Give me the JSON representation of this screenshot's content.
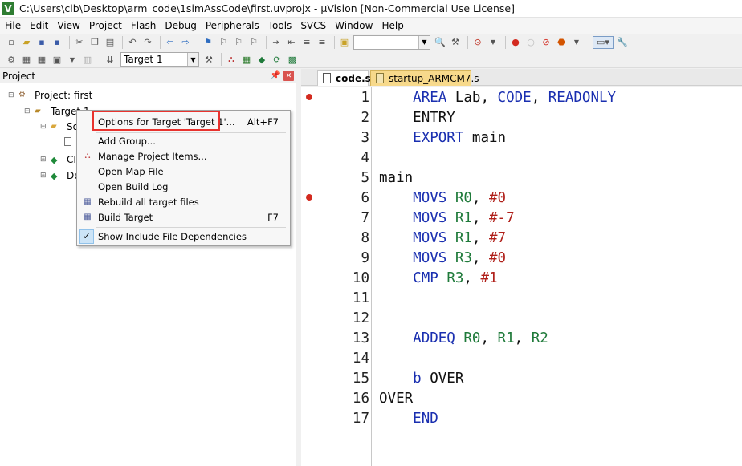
{
  "window": {
    "title": "C:\\Users\\clb\\Desktop\\arm_code\\1simAssCode\\first.uvprojx - µVision  [Non-Commercial Use License]",
    "app_icon_letter": "V"
  },
  "menubar": {
    "items": [
      "File",
      "Edit",
      "View",
      "Project",
      "Flash",
      "Debug",
      "Peripherals",
      "Tools",
      "SVCS",
      "Window",
      "Help"
    ]
  },
  "toolbar2": {
    "target_select": "Target 1"
  },
  "project_pane": {
    "header": "Project",
    "tree": {
      "project": "Project: first",
      "target": "Target 1",
      "group1_partial": "So",
      "group2_partial": "CI",
      "group3_partial": "De"
    }
  },
  "context_menu": {
    "items": [
      {
        "label": "Options for Target 'Target 1'...",
        "shortcut": "Alt+F7"
      },
      {
        "label": "Add Group...",
        "shortcut": ""
      },
      {
        "label": "Manage Project Items...",
        "shortcut": ""
      },
      {
        "label": "Open Map File",
        "shortcut": ""
      },
      {
        "label": "Open Build Log",
        "shortcut": ""
      },
      {
        "label": "Rebuild all target files",
        "shortcut": ""
      },
      {
        "label": "Build Target",
        "shortcut": "F7"
      },
      {
        "label": "Show Include File Dependencies",
        "shortcut": ""
      }
    ]
  },
  "editor": {
    "tabs": [
      {
        "label": "code.s",
        "active": true
      },
      {
        "label": "startup_ARMCM7.s",
        "active": false
      }
    ],
    "breakpoint_lines": [
      1,
      6
    ],
    "lines": [
      {
        "n": "1",
        "indent": "    ",
        "tokens": [
          {
            "t": "AREA",
            "c": "kw"
          },
          {
            "t": " Lab, ",
            "c": "plain"
          },
          {
            "t": "CODE",
            "c": "kw"
          },
          {
            "t": ", ",
            "c": "plain"
          },
          {
            "t": "READONLY",
            "c": "kw"
          }
        ]
      },
      {
        "n": "2",
        "indent": "    ",
        "tokens": [
          {
            "t": "ENTRY",
            "c": "plain"
          }
        ]
      },
      {
        "n": "3",
        "indent": "    ",
        "tokens": [
          {
            "t": "EXPORT",
            "c": "kw"
          },
          {
            "t": " main",
            "c": "plain"
          }
        ]
      },
      {
        "n": "4",
        "indent": "",
        "tokens": []
      },
      {
        "n": "5",
        "indent": "",
        "tokens": [
          {
            "t": "main",
            "c": "plain"
          }
        ]
      },
      {
        "n": "6",
        "indent": "    ",
        "tokens": [
          {
            "t": "MOVS",
            "c": "kw"
          },
          {
            "t": " ",
            "c": "plain"
          },
          {
            "t": "R0",
            "c": "reg"
          },
          {
            "t": ", ",
            "c": "plain"
          },
          {
            "t": "#0",
            "c": "num"
          }
        ]
      },
      {
        "n": "7",
        "indent": "    ",
        "tokens": [
          {
            "t": "MOVS",
            "c": "kw"
          },
          {
            "t": " ",
            "c": "plain"
          },
          {
            "t": "R1",
            "c": "reg"
          },
          {
            "t": ", ",
            "c": "plain"
          },
          {
            "t": "#-7",
            "c": "num"
          }
        ]
      },
      {
        "n": "8",
        "indent": "    ",
        "tokens": [
          {
            "t": "MOVS",
            "c": "kw"
          },
          {
            "t": " ",
            "c": "plain"
          },
          {
            "t": "R1",
            "c": "reg"
          },
          {
            "t": ", ",
            "c": "plain"
          },
          {
            "t": "#7",
            "c": "num"
          }
        ]
      },
      {
        "n": "9",
        "indent": "    ",
        "tokens": [
          {
            "t": "MOVS",
            "c": "kw"
          },
          {
            "t": " ",
            "c": "plain"
          },
          {
            "t": "R3",
            "c": "reg"
          },
          {
            "t": ", ",
            "c": "plain"
          },
          {
            "t": "#0",
            "c": "num"
          }
        ]
      },
      {
        "n": "10",
        "indent": "    ",
        "tokens": [
          {
            "t": "CMP",
            "c": "kw"
          },
          {
            "t": " ",
            "c": "plain"
          },
          {
            "t": "R3",
            "c": "reg"
          },
          {
            "t": ", ",
            "c": "plain"
          },
          {
            "t": "#1",
            "c": "num"
          }
        ]
      },
      {
        "n": "11",
        "indent": "",
        "tokens": []
      },
      {
        "n": "12",
        "indent": "",
        "tokens": []
      },
      {
        "n": "13",
        "indent": "    ",
        "tokens": [
          {
            "t": "ADDEQ",
            "c": "kw"
          },
          {
            "t": " ",
            "c": "plain"
          },
          {
            "t": "R0",
            "c": "reg"
          },
          {
            "t": ", ",
            "c": "plain"
          },
          {
            "t": "R1",
            "c": "reg"
          },
          {
            "t": ", ",
            "c": "plain"
          },
          {
            "t": "R2",
            "c": "reg"
          }
        ]
      },
      {
        "n": "14",
        "indent": "",
        "tokens": []
      },
      {
        "n": "15",
        "indent": "    ",
        "tokens": [
          {
            "t": "b",
            "c": "kw"
          },
          {
            "t": " OVER",
            "c": "plain"
          }
        ]
      },
      {
        "n": "16",
        "indent": "",
        "tokens": [
          {
            "t": "OVER",
            "c": "plain"
          }
        ]
      },
      {
        "n": "17",
        "indent": "    ",
        "tokens": [
          {
            "t": "END",
            "c": "kw"
          }
        ]
      }
    ]
  },
  "colors": {
    "keyword": "#1a2fb0",
    "register": "#1f7a3a",
    "number": "#b0201a",
    "breakpoint": "#d32a1f",
    "highlight": "#e8332e"
  }
}
